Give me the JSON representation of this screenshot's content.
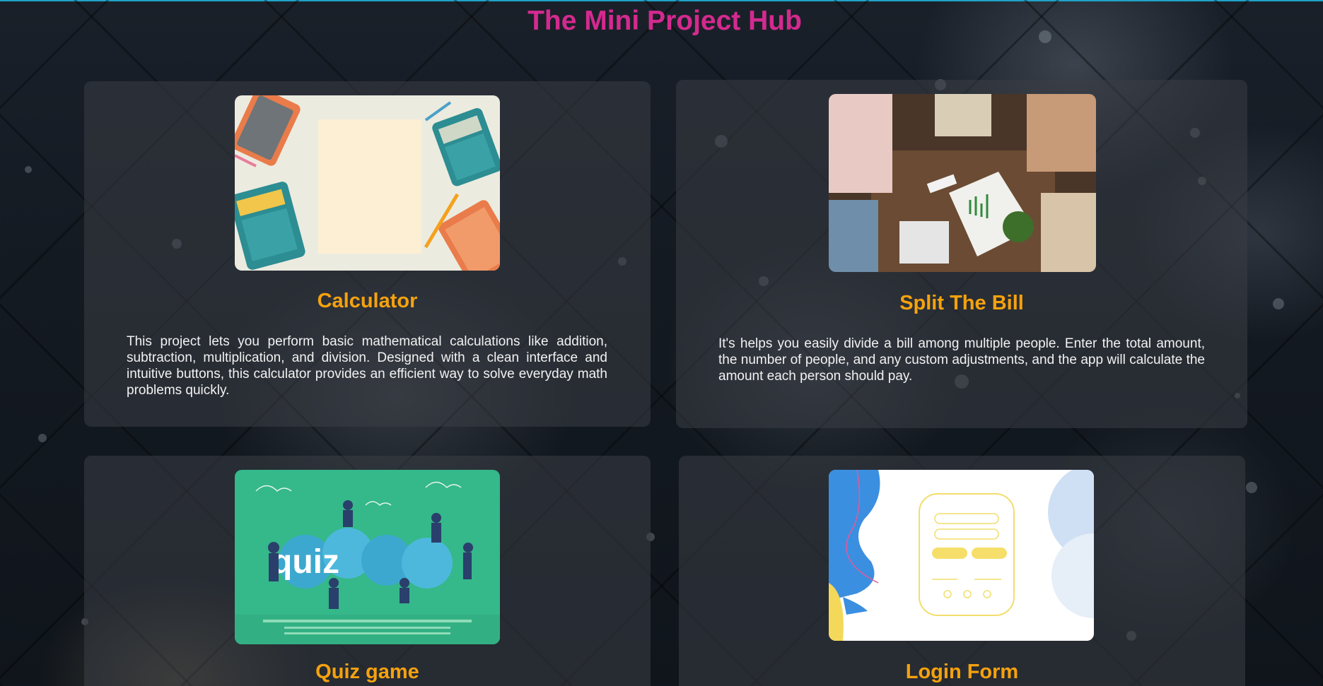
{
  "page": {
    "title": "The Mini Project Hub"
  },
  "colors": {
    "title": "#d42a8f",
    "card_title": "#f5a20e",
    "card_text": "#f2f2f2",
    "top_accent": "#1fa3c9"
  },
  "cards": [
    {
      "title": "Calculator",
      "description": "This project lets you perform basic mathematical calculations like addition, subtraction, multiplication, and division. Designed with a clean interface and intuitive buttons, this calculator provides an efficient way to solve everyday math problems quickly.",
      "image": "calculators-illustration"
    },
    {
      "title": "Split The Bill",
      "description": "It's helps you easily divide a bill among multiple people. Enter the total amount, the number of people, and any custom adjustments, and the app will calculate the amount each person should pay.",
      "image": "people-at-table-photo"
    },
    {
      "title": "Quiz game",
      "description": "",
      "image": "quiz-illustration",
      "image_text": "quiz"
    },
    {
      "title": "Login Form",
      "description": "",
      "image": "login-form-illustration"
    }
  ]
}
